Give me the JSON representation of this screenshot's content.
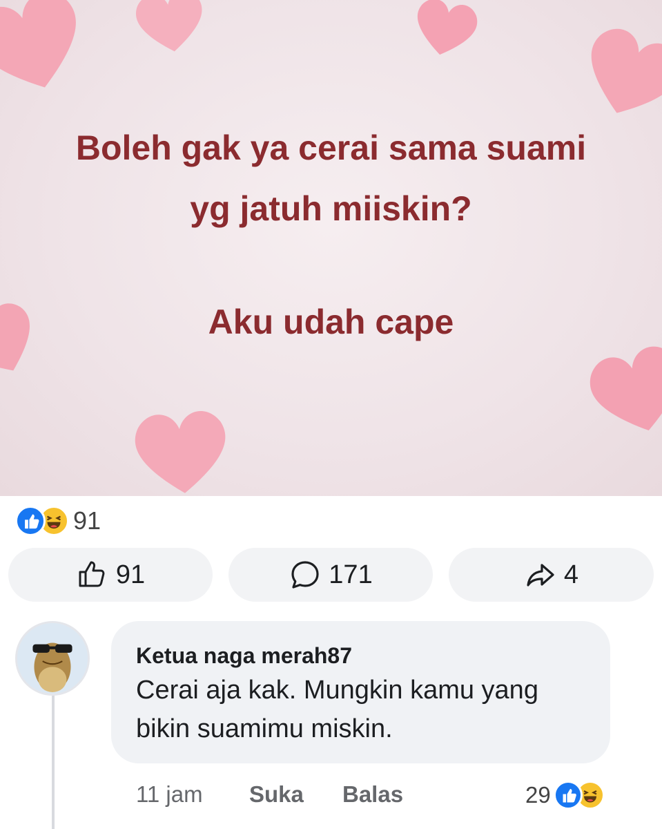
{
  "post": {
    "lines": [
      "Boleh gak ya cerai sama suami",
      "yg jatuh miiskin?",
      "Aku udah cape"
    ],
    "text_color": "#8b2b2f"
  },
  "reactions": {
    "icons": [
      "like-icon",
      "haha-icon"
    ],
    "total": "91"
  },
  "actions": {
    "like_count": "91",
    "comment_count": "171",
    "share_count": "4"
  },
  "comment": {
    "author": "Ketua naga merah87",
    "text": "Cerai aja kak. Mungkin kamu yang bikin suamimu miskin.",
    "time": "11 jam",
    "like_label": "Suka",
    "reply_label": "Balas",
    "reaction_count": "29",
    "reaction_icons": [
      "like-icon",
      "haha-icon"
    ]
  },
  "colors": {
    "accent": "#1877f2",
    "haha": "#f7c22e",
    "muted": "#65676b",
    "heart": "#f4a7b6"
  }
}
